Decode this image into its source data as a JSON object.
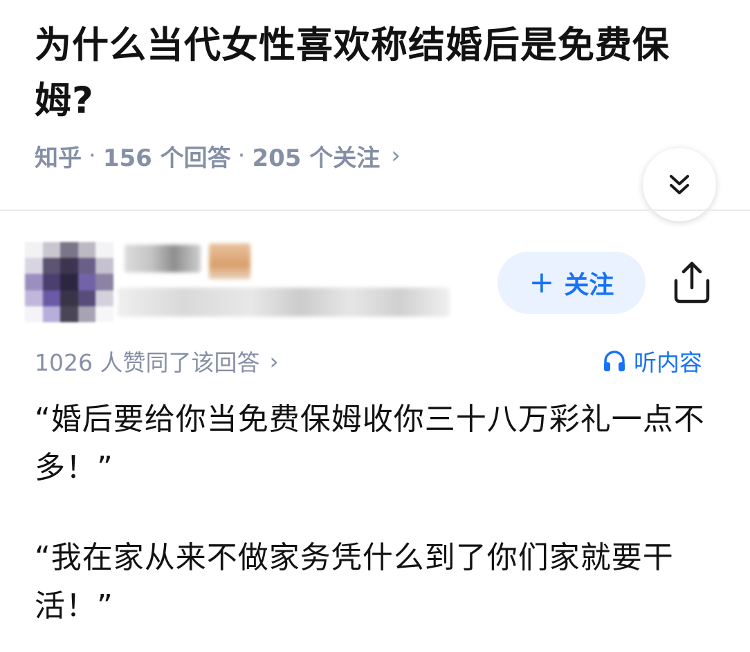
{
  "question": {
    "title": "为什么当代女性喜欢称结婚后是免费保姆?"
  },
  "meta": {
    "site": "知乎",
    "separator": "·",
    "answers_count": "156 个回答",
    "followers_count": "205 个关注",
    "chevron": "›"
  },
  "icons": {
    "collapse": "double-chevron-down-icon",
    "share": "share-icon",
    "listen": "headphones-icon"
  },
  "author": {
    "name_blurred": true
  },
  "follow_button": {
    "plus": "+",
    "label": "关注"
  },
  "answer": {
    "upvote_text": "1026 人赞同了该回答",
    "upvote_chevron": "›",
    "listen_label": "听内容",
    "paragraphs": [
      "“婚后要给你当免费保姆收你三十八万彩礼一点不多！”",
      "“我在家从来不做家务凭什么到了你们家就要干活！”"
    ]
  },
  "colors": {
    "accent": "#1772f6",
    "follow_bg": "#eaf2ff",
    "meta_gray": "#8590a6",
    "title": "#121212",
    "divider": "#ebebeb"
  }
}
